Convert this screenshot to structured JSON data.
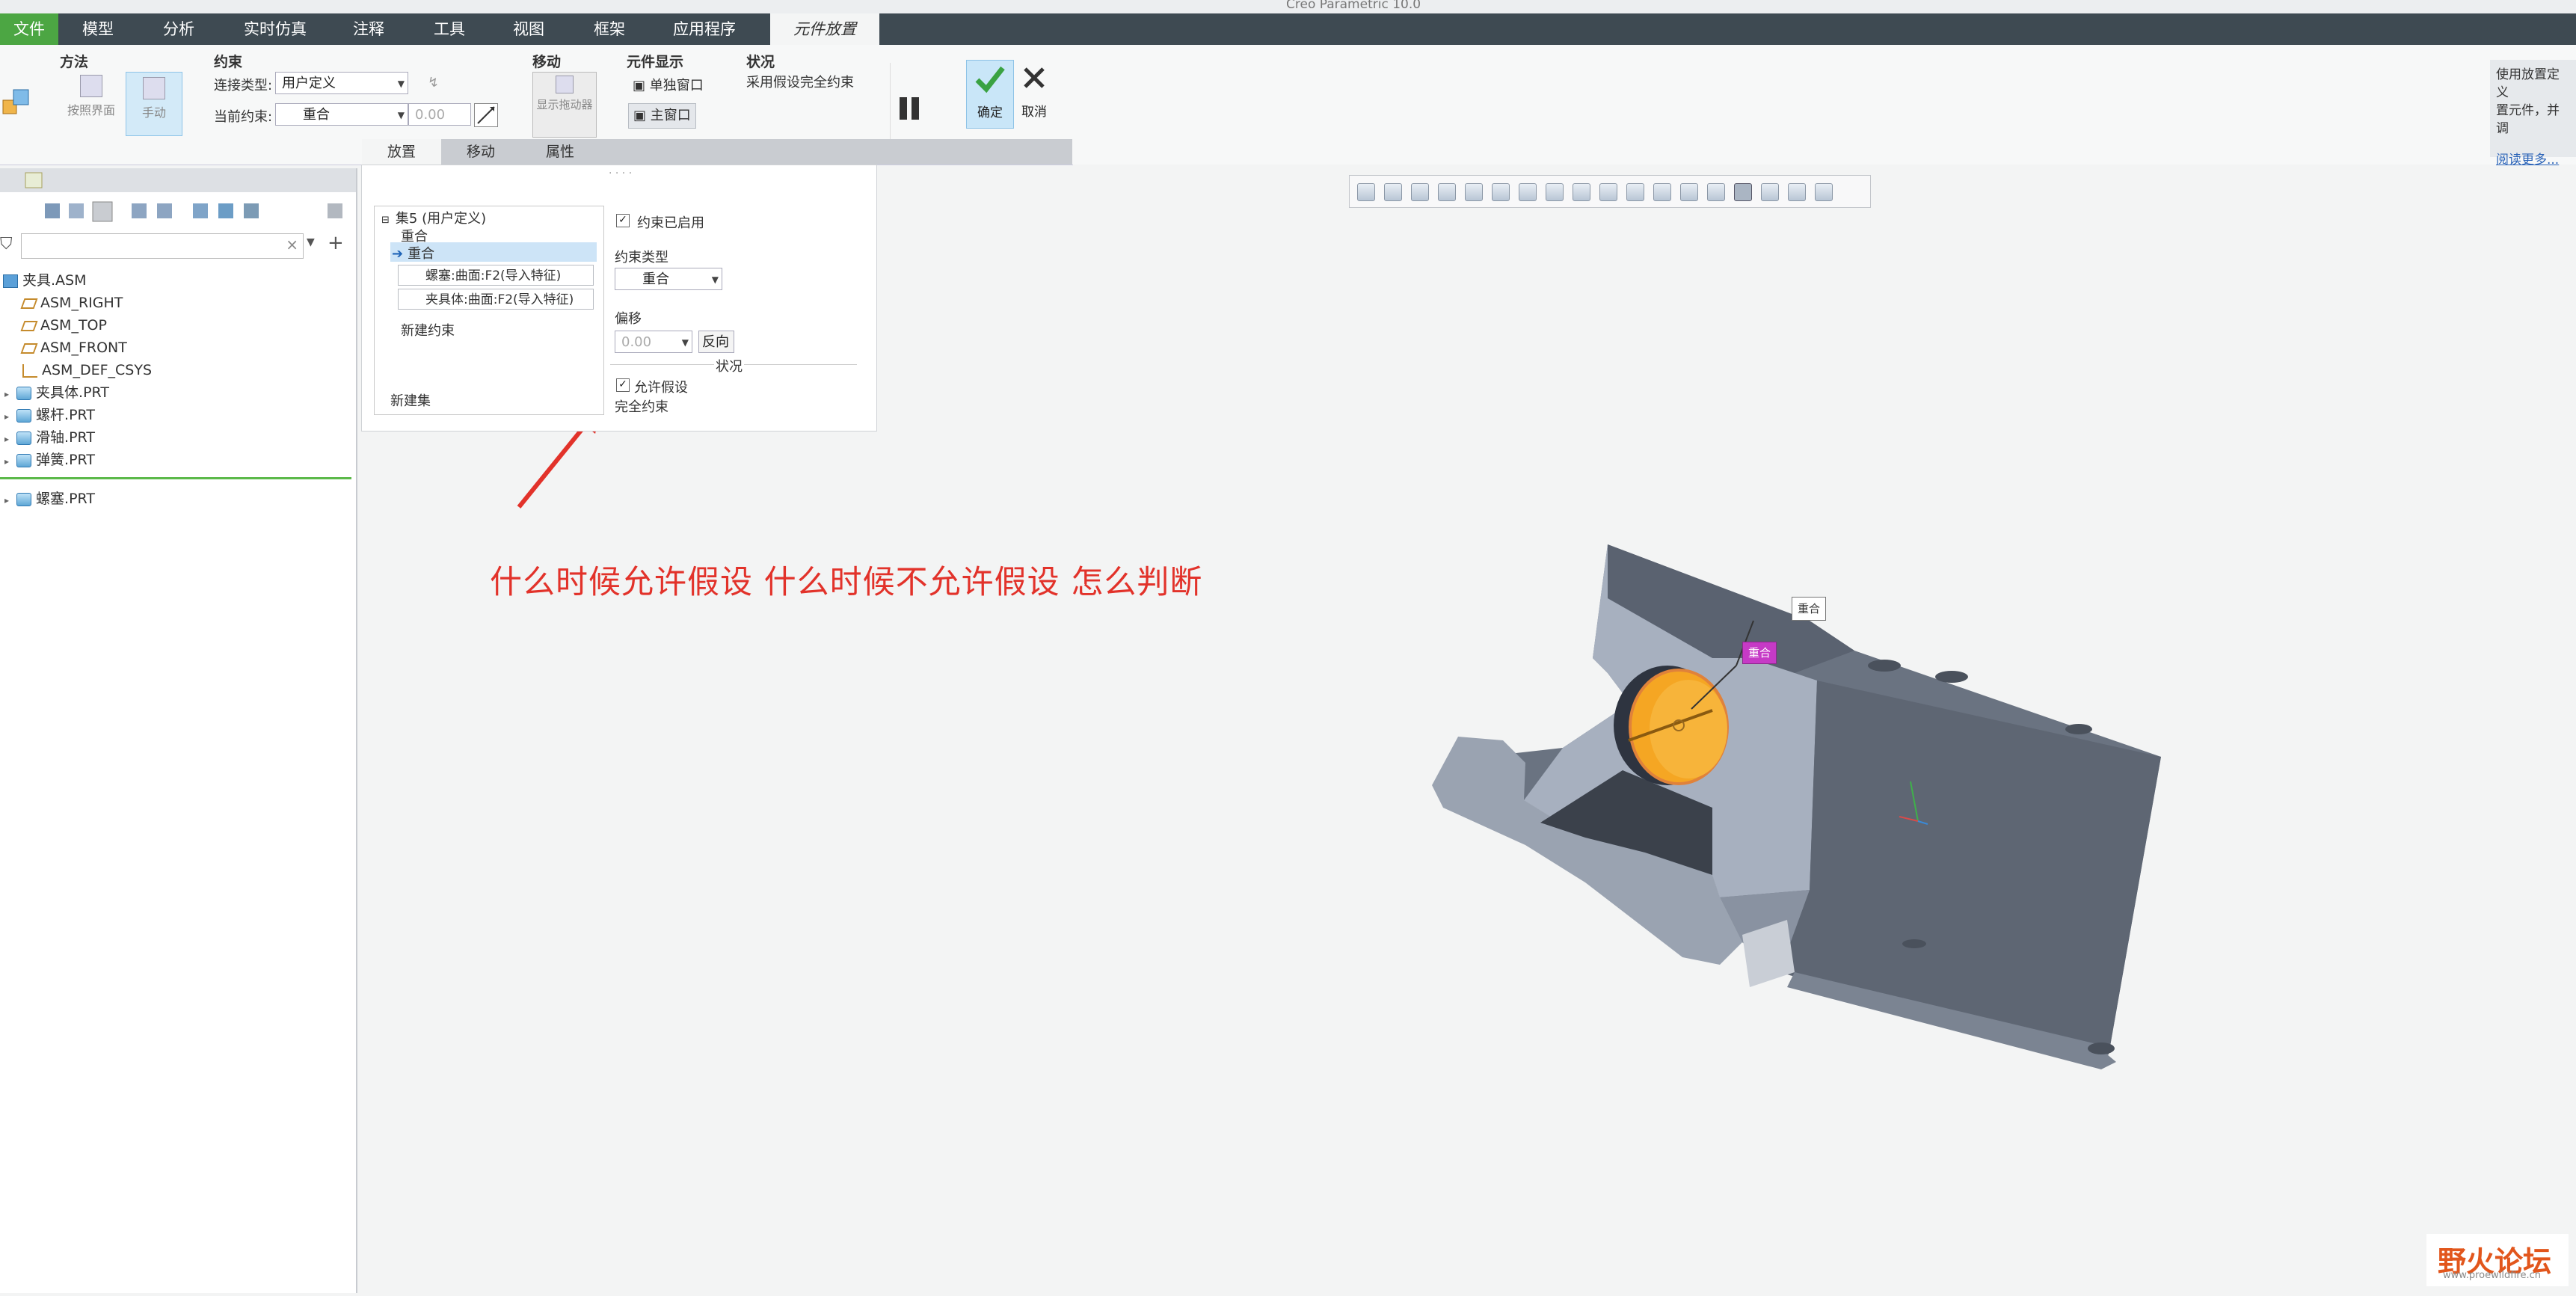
{
  "title": "Creo Parametric 10.0",
  "menu": {
    "file": "文件",
    "items": [
      "模型",
      "分析",
      "实时仿真",
      "注释",
      "工具",
      "视图",
      "框架",
      "应用程序"
    ],
    "active_tab": "元件放置"
  },
  "ribbon": {
    "method": {
      "title": "方法",
      "interface_label": "按照界面",
      "manual_label": "手动"
    },
    "constraint": {
      "title": "约束",
      "connection_type_label": "连接类型:",
      "connection_type_value": "用户定义",
      "current_constraint_label": "当前约束:",
      "current_constraint_value": "重合",
      "offset_value": "0.00"
    },
    "move": {
      "title": "移动",
      "drag_label": "显示拖动器"
    },
    "component_display": {
      "title": "元件显示",
      "separate_window": "单独窗口",
      "main_window": "主窗口"
    },
    "status": {
      "title": "状况",
      "text": "采用假设完全约束"
    },
    "ok_label": "确定",
    "cancel_label": "取消",
    "tabs": [
      "放置",
      "移动",
      "属性"
    ]
  },
  "help": {
    "text": "使用放置定义\n置元件，并调",
    "link": "阅读更多..."
  },
  "model_tree": {
    "items": [
      {
        "label": "夹具.ASM",
        "icon": "assembly-icon"
      },
      {
        "label": "ASM_RIGHT",
        "icon": "datum-plane-icon"
      },
      {
        "label": "ASM_TOP",
        "icon": "datum-plane-icon"
      },
      {
        "label": "ASM_FRONT",
        "icon": "datum-plane-icon"
      },
      {
        "label": "ASM_DEF_CSYS",
        "icon": "coordinate-system-icon"
      },
      {
        "label": "夹具体.PRT",
        "icon": "part-icon"
      },
      {
        "label": "螺杆.PRT",
        "icon": "part-icon"
      },
      {
        "label": "滑轴.PRT",
        "icon": "part-icon"
      },
      {
        "label": "弹簧.PRT",
        "icon": "part-icon"
      }
    ],
    "placing_item": "螺塞.PRT"
  },
  "placement": {
    "set_title": "集5 (用户定义)",
    "set_type": "重合",
    "selected_constraint": "重合",
    "refs": [
      "螺塞:曲面:F2(导入特征)",
      "夹具体:曲面:F2(导入特征)"
    ],
    "new_constraint": "新建约束",
    "new_set": "新建集",
    "constraint_enabled_label": "约束已启用",
    "constraint_type_label": "约束类型",
    "constraint_type_value": "重合",
    "offset_label": "偏移",
    "offset_value": "0.00",
    "flip_label": "反向",
    "status_label": "状况",
    "allow_assumptions_label": "允许假设",
    "status_text": "完全约束"
  },
  "viewport": {
    "tag1": "重合",
    "tag2": "重合"
  },
  "annotation": "什么时候允许假设  什么时候不允许假设  怎么判断",
  "watermark": {
    "brand": "野火论坛",
    "url": "www.proewildfire.cn"
  },
  "colors": {
    "accent_green": "#4ca643",
    "menu_bg": "#3e4a52",
    "annotation_red": "#e2322a",
    "part_orange": "#f5a623"
  }
}
